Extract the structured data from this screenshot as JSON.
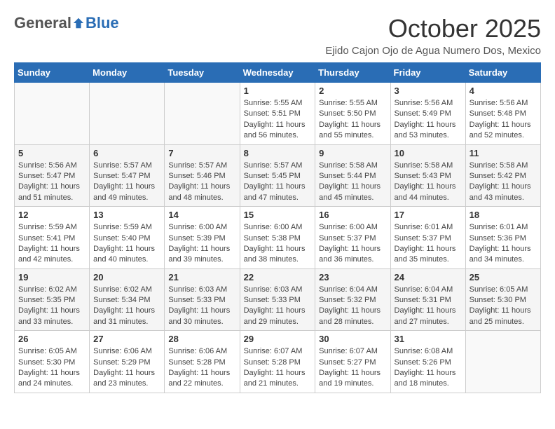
{
  "logo": {
    "general": "General",
    "blue": "Blue"
  },
  "title": "October 2025",
  "location": "Ejido Cajon Ojo de Agua Numero Dos, Mexico",
  "days_header": [
    "Sunday",
    "Monday",
    "Tuesday",
    "Wednesday",
    "Thursday",
    "Friday",
    "Saturday"
  ],
  "weeks": [
    [
      {
        "day": "",
        "info": ""
      },
      {
        "day": "",
        "info": ""
      },
      {
        "day": "",
        "info": ""
      },
      {
        "day": "1",
        "info": "Sunrise: 5:55 AM\nSunset: 5:51 PM\nDaylight: 11 hours and 56 minutes."
      },
      {
        "day": "2",
        "info": "Sunrise: 5:55 AM\nSunset: 5:50 PM\nDaylight: 11 hours and 55 minutes."
      },
      {
        "day": "3",
        "info": "Sunrise: 5:56 AM\nSunset: 5:49 PM\nDaylight: 11 hours and 53 minutes."
      },
      {
        "day": "4",
        "info": "Sunrise: 5:56 AM\nSunset: 5:48 PM\nDaylight: 11 hours and 52 minutes."
      }
    ],
    [
      {
        "day": "5",
        "info": "Sunrise: 5:56 AM\nSunset: 5:47 PM\nDaylight: 11 hours and 51 minutes."
      },
      {
        "day": "6",
        "info": "Sunrise: 5:57 AM\nSunset: 5:47 PM\nDaylight: 11 hours and 49 minutes."
      },
      {
        "day": "7",
        "info": "Sunrise: 5:57 AM\nSunset: 5:46 PM\nDaylight: 11 hours and 48 minutes."
      },
      {
        "day": "8",
        "info": "Sunrise: 5:57 AM\nSunset: 5:45 PM\nDaylight: 11 hours and 47 minutes."
      },
      {
        "day": "9",
        "info": "Sunrise: 5:58 AM\nSunset: 5:44 PM\nDaylight: 11 hours and 45 minutes."
      },
      {
        "day": "10",
        "info": "Sunrise: 5:58 AM\nSunset: 5:43 PM\nDaylight: 11 hours and 44 minutes."
      },
      {
        "day": "11",
        "info": "Sunrise: 5:58 AM\nSunset: 5:42 PM\nDaylight: 11 hours and 43 minutes."
      }
    ],
    [
      {
        "day": "12",
        "info": "Sunrise: 5:59 AM\nSunset: 5:41 PM\nDaylight: 11 hours and 42 minutes."
      },
      {
        "day": "13",
        "info": "Sunrise: 5:59 AM\nSunset: 5:40 PM\nDaylight: 11 hours and 40 minutes."
      },
      {
        "day": "14",
        "info": "Sunrise: 6:00 AM\nSunset: 5:39 PM\nDaylight: 11 hours and 39 minutes."
      },
      {
        "day": "15",
        "info": "Sunrise: 6:00 AM\nSunset: 5:38 PM\nDaylight: 11 hours and 38 minutes."
      },
      {
        "day": "16",
        "info": "Sunrise: 6:00 AM\nSunset: 5:37 PM\nDaylight: 11 hours and 36 minutes."
      },
      {
        "day": "17",
        "info": "Sunrise: 6:01 AM\nSunset: 5:37 PM\nDaylight: 11 hours and 35 minutes."
      },
      {
        "day": "18",
        "info": "Sunrise: 6:01 AM\nSunset: 5:36 PM\nDaylight: 11 hours and 34 minutes."
      }
    ],
    [
      {
        "day": "19",
        "info": "Sunrise: 6:02 AM\nSunset: 5:35 PM\nDaylight: 11 hours and 33 minutes."
      },
      {
        "day": "20",
        "info": "Sunrise: 6:02 AM\nSunset: 5:34 PM\nDaylight: 11 hours and 31 minutes."
      },
      {
        "day": "21",
        "info": "Sunrise: 6:03 AM\nSunset: 5:33 PM\nDaylight: 11 hours and 30 minutes."
      },
      {
        "day": "22",
        "info": "Sunrise: 6:03 AM\nSunset: 5:33 PM\nDaylight: 11 hours and 29 minutes."
      },
      {
        "day": "23",
        "info": "Sunrise: 6:04 AM\nSunset: 5:32 PM\nDaylight: 11 hours and 28 minutes."
      },
      {
        "day": "24",
        "info": "Sunrise: 6:04 AM\nSunset: 5:31 PM\nDaylight: 11 hours and 27 minutes."
      },
      {
        "day": "25",
        "info": "Sunrise: 6:05 AM\nSunset: 5:30 PM\nDaylight: 11 hours and 25 minutes."
      }
    ],
    [
      {
        "day": "26",
        "info": "Sunrise: 6:05 AM\nSunset: 5:30 PM\nDaylight: 11 hours and 24 minutes."
      },
      {
        "day": "27",
        "info": "Sunrise: 6:06 AM\nSunset: 5:29 PM\nDaylight: 11 hours and 23 minutes."
      },
      {
        "day": "28",
        "info": "Sunrise: 6:06 AM\nSunset: 5:28 PM\nDaylight: 11 hours and 22 minutes."
      },
      {
        "day": "29",
        "info": "Sunrise: 6:07 AM\nSunset: 5:28 PM\nDaylight: 11 hours and 21 minutes."
      },
      {
        "day": "30",
        "info": "Sunrise: 6:07 AM\nSunset: 5:27 PM\nDaylight: 11 hours and 19 minutes."
      },
      {
        "day": "31",
        "info": "Sunrise: 6:08 AM\nSunset: 5:26 PM\nDaylight: 11 hours and 18 minutes."
      },
      {
        "day": "",
        "info": ""
      }
    ]
  ]
}
